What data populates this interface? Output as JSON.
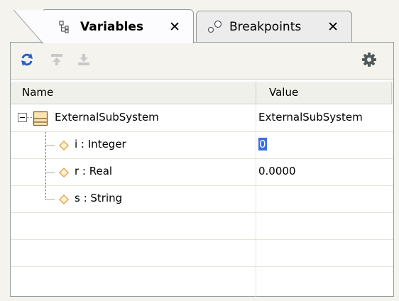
{
  "tabs": [
    {
      "label": "Variables",
      "active": true,
      "close": "✕"
    },
    {
      "label": "Breakpoints",
      "active": false,
      "close": "✕"
    }
  ],
  "toolbar": {
    "refresh_icon": "refresh-icon",
    "expand_icon": "expand-all-icon",
    "collapse_icon": "collapse-all-icon",
    "options_icon": "gear-icon"
  },
  "grid": {
    "col_name": "Name",
    "col_value": "Value",
    "rows": [
      {
        "name": "ExternalSubSystem",
        "value": "ExternalSubSystem"
      },
      {
        "name": "i : Integer",
        "value": "0"
      },
      {
        "name": "r : Real",
        "value": "0.0000"
      },
      {
        "name": "s : String",
        "value": ""
      }
    ]
  },
  "colors": {
    "accent": "#3a6ee0",
    "border": "#919b9c",
    "toolbar_bg": "#f4f3ee",
    "property_icon": "#e6a24a"
  }
}
